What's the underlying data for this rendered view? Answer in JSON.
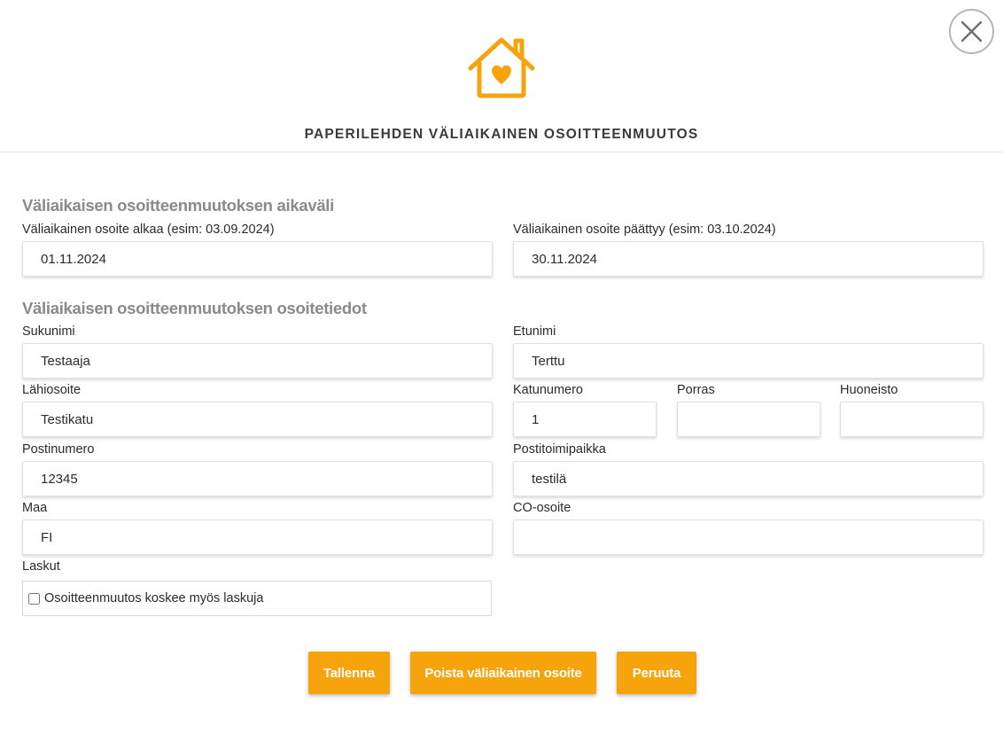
{
  "header": {
    "title": "PAPERILEHDEN VÄLIAIKAINEN OSOITTEENMUUTOS",
    "logo_icon": "house-heart-icon",
    "close_icon": "close-icon",
    "accent_color": "#f7a30c"
  },
  "period_section": {
    "heading": "Väliaikaisen osoitteenmuutoksen aikaväli",
    "start_label": "Väliaikainen osoite alkaa (esim: 03.09.2024)",
    "start_value": "01.11.2024",
    "end_label": "Väliaikainen osoite päättyy (esim: 03.10.2024)",
    "end_value": "30.11.2024"
  },
  "address_section": {
    "heading": "Väliaikaisen osoitteenmuutoksen osoitetiedot",
    "surname_label": "Sukunimi",
    "surname_value": "Testaaja",
    "firstname_label": "Etunimi",
    "firstname_value": "Terttu",
    "street_label": "Lähiosoite",
    "street_value": "Testikatu",
    "street_number_label": "Katunumero",
    "street_number_value": "1",
    "stairway_label": "Porras",
    "stairway_value": "",
    "apartment_label": "Huoneisto",
    "apartment_value": "",
    "postal_code_label": "Postinumero",
    "postal_code_value": "12345",
    "city_label": "Postitoimipaikka",
    "city_value": "testilä",
    "country_label": "Maa",
    "country_value": "FI",
    "co_label": "CO-osoite",
    "co_value": "",
    "invoices_label": "Laskut",
    "invoices_checkbox_label": "Osoitteenmuutos koskee myös laskuja",
    "invoices_checked": false
  },
  "actions": {
    "save_label": "Tallenna",
    "delete_label": "Poista väliaikainen osoite",
    "cancel_label": "Peruuta"
  }
}
